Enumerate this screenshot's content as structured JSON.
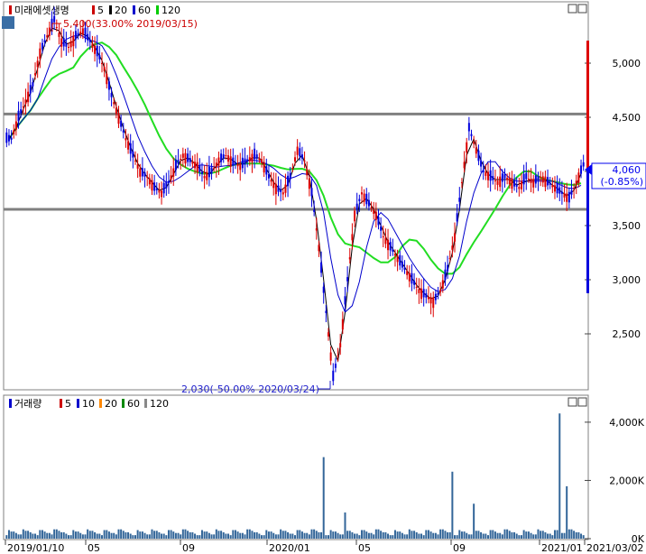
{
  "chart_data": [
    {
      "type": "candlestick",
      "name": "미래에셋생명",
      "legend": {
        "title": "미래에셋생명",
        "items": [
          {
            "label": "5",
            "color": "#cc0000"
          },
          {
            "label": "20",
            "color": "#000000"
          },
          {
            "label": "60",
            "color": "#0000cc"
          },
          {
            "label": "120",
            "color": "#00cc00"
          }
        ]
      },
      "y_ticks": [
        "5,000",
        "4,500",
        "4,000",
        "3,500",
        "3,000",
        "2,500"
      ],
      "ylim": [
        2000,
        5500
      ],
      "current_price": {
        "value": "4,060",
        "change": "(-0.85%)"
      },
      "high_annotation": "5,400(33.00% 2019/03/15)",
      "low_annotation": "2,030(-50.00% 2020/03/24)",
      "horizontal_lines": [
        4530,
        3650
      ],
      "x_ticks": [
        "2019/01/10",
        "05",
        "09",
        "2020/01",
        "05",
        "09",
        "2021/01",
        "2021/03/02"
      ],
      "close_series": [
        4300,
        4500,
        4650,
        4800,
        5100,
        5250,
        5400,
        5200,
        5150,
        5250,
        5300,
        5200,
        5100,
        4950,
        4700,
        4500,
        4300,
        4150,
        4000,
        3950,
        3850,
        3800,
        3900,
        4050,
        4150,
        4100,
        4050,
        3950,
        4000,
        4100,
        4150,
        4080,
        4050,
        4100,
        4150,
        4100,
        3950,
        3850,
        3800,
        3950,
        4200,
        4100,
        3800,
        3300,
        2700,
        2100,
        2400,
        3000,
        3600,
        3800,
        3700,
        3600,
        3400,
        3300,
        3200,
        3100,
        3000,
        2900,
        2850,
        2800,
        2900,
        3100,
        3400,
        3900,
        4400,
        4200,
        4000,
        3950,
        3900,
        3950,
        3900,
        3850,
        3950,
        3900,
        3950,
        3900,
        3850,
        3800,
        3750,
        3900,
        4060
      ],
      "volume": {
        "legend": {
          "title": "거래량",
          "items": [
            {
              "label": "5",
              "color": "#cc0000"
            },
            {
              "label": "10",
              "color": "#0000cc"
            },
            {
              "label": "20",
              "color": "#ff8800"
            },
            {
              "label": "60",
              "color": "#008800"
            },
            {
              "label": "120",
              "color": "#888888"
            }
          ]
        },
        "y_ticks": [
          "4,000K",
          "2,000K",
          "0K"
        ],
        "ylim": [
          0,
          4400
        ],
        "spikes": [
          {
            "index": 44,
            "value": 2800
          },
          {
            "index": 47,
            "value": 900
          },
          {
            "index": 62,
            "value": 2300
          },
          {
            "index": 65,
            "value": 1200
          },
          {
            "index": 77,
            "value": 4300
          },
          {
            "index": 78,
            "value": 1800
          }
        ]
      }
    }
  ]
}
